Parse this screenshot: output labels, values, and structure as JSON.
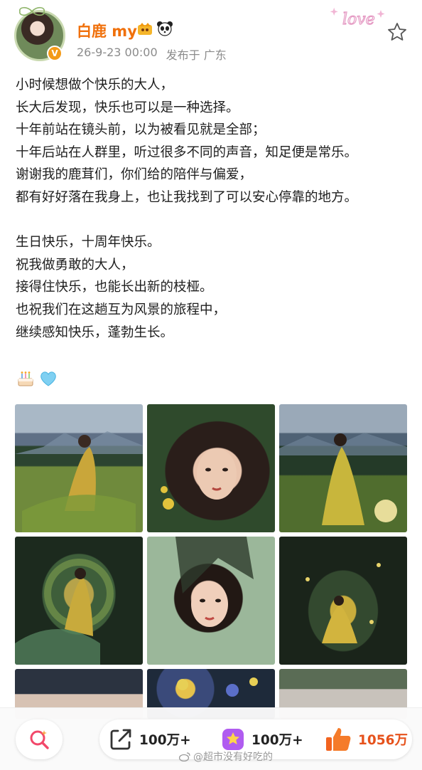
{
  "post": {
    "user_name": "白鹿 my",
    "date": "26-9-23 00:00",
    "location": "发布于 广东",
    "body_lines": [
      "小时候想做个快乐的大人，",
      "长大后发现，快乐也可以是一种选择。",
      "十年前站在镜头前，以为被看见就是全部；",
      "十年后站在人群里，听过很多不同的声音，知足便是常乐。",
      "谢谢我的鹿茸们，你们给的陪伴与偏爱，",
      "都有好好落在我身上，也让我找到了可以安心停靠的地方。",
      "",
      "生日快乐，十周年快乐。",
      "祝我做勇敢的大人，",
      "接得住快乐，也能长出新的枝桠。",
      "也祝我们在这趟互为风景的旅程中，",
      "继续感知快乐，蓬勃生长。"
    ],
    "emojis": [
      "cake-icon",
      "light-blue-heart-icon"
    ],
    "photos": [
      "photo-1",
      "photo-2",
      "photo-3",
      "photo-4",
      "photo-5",
      "photo-6",
      "photo-7",
      "photo-8",
      "photo-9"
    ]
  },
  "actions": {
    "share_count": "100万+",
    "comment_count": "100万+",
    "like_count": "1056万"
  },
  "watermark": "@超市没有好吃的",
  "deco": {
    "love_text": "love"
  },
  "colors": {
    "name": "#f0700b",
    "meta": "#8b8b8b",
    "liked": "#e6521c",
    "verified": "#f39a17"
  },
  "icons": {
    "favorite": "star-outline-icon",
    "search": "search-icon",
    "share": "share-icon",
    "comment": "comment-icon",
    "like": "thumbs-up-icon"
  }
}
